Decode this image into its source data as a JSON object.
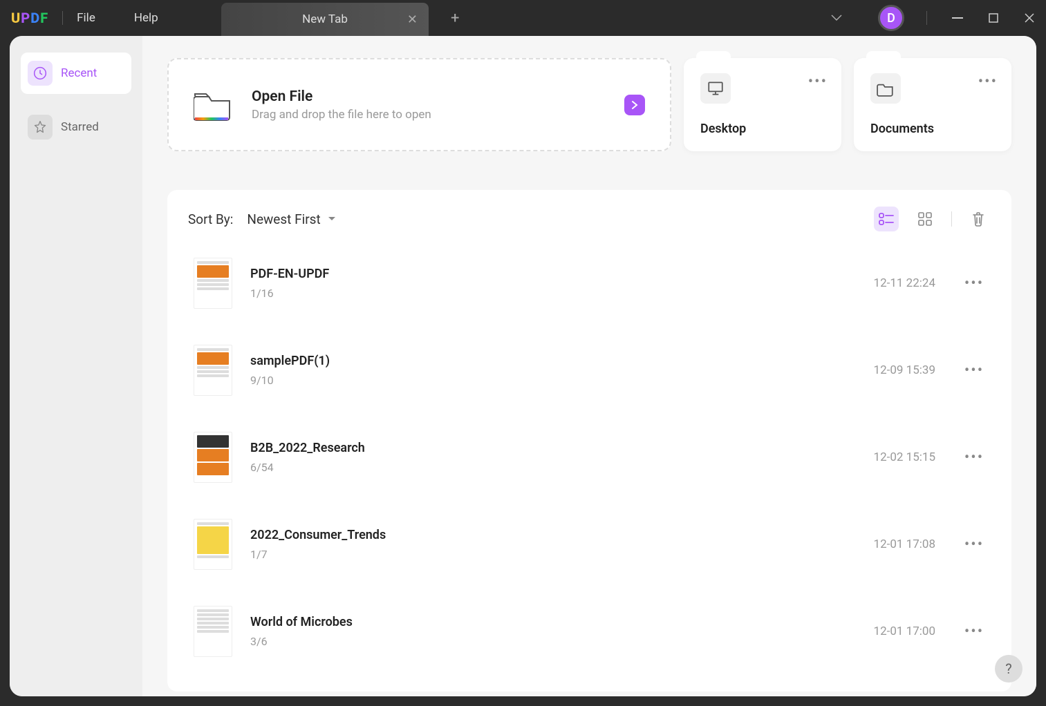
{
  "app": {
    "logo_u": "U",
    "logo_p": "P",
    "logo_d": "D",
    "logo_f": "F"
  },
  "menu": {
    "file": "File",
    "help": "Help"
  },
  "tab": {
    "label": "New Tab"
  },
  "avatar": {
    "letter": "D"
  },
  "sidebar": {
    "recent": "Recent",
    "starred": "Starred"
  },
  "open_file": {
    "title": "Open File",
    "hint": "Drag and drop the file here to open"
  },
  "quick": {
    "desktop": "Desktop",
    "documents": "Documents"
  },
  "sort": {
    "label": "Sort By:",
    "value": "Newest First"
  },
  "files": [
    {
      "name": "PDF-EN-UPDF",
      "pages": "1/16",
      "date": "12-11 22:24"
    },
    {
      "name": "samplePDF(1)",
      "pages": "9/10",
      "date": "12-09 15:39"
    },
    {
      "name": "B2B_2022_Research",
      "pages": "6/54",
      "date": "12-02 15:15"
    },
    {
      "name": "2022_Consumer_Trends",
      "pages": "1/7",
      "date": "12-01 17:08"
    },
    {
      "name": "World of Microbes",
      "pages": "3/6",
      "date": "12-01 17:00"
    }
  ],
  "help_fab": "?"
}
